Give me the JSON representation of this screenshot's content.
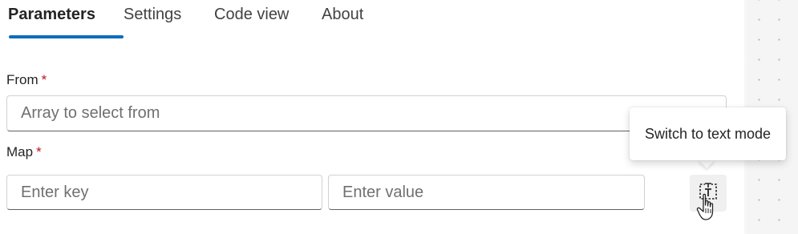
{
  "tabs": [
    {
      "label": "Parameters",
      "active": true
    },
    {
      "label": "Settings",
      "active": false
    },
    {
      "label": "Code view",
      "active": false
    },
    {
      "label": "About",
      "active": false
    }
  ],
  "from": {
    "label": "From",
    "required_mark": "*",
    "placeholder": "Array to select from"
  },
  "map": {
    "label": "Map",
    "required_mark": "*",
    "key_placeholder": "Enter key",
    "value_placeholder": "Enter value"
  },
  "text_mode_button": {
    "icon": "text-mode-icon",
    "tooltip": "Switch to text mode"
  },
  "colors": {
    "accent": "#0f6cbd",
    "required": "#c50f1f"
  }
}
